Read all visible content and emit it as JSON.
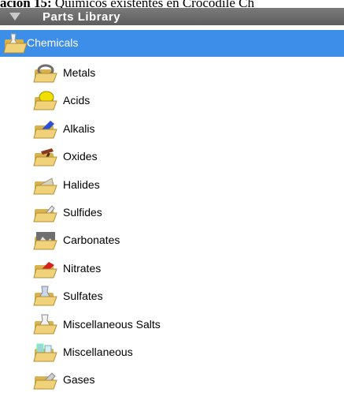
{
  "caption": {
    "bold_part": "ación 15:",
    "rest": " Químicos existentes en Crocodile Ch"
  },
  "panel": {
    "title": "Parts Library"
  },
  "tree": {
    "root": {
      "label": "Chemicals",
      "icon": "folder-flask-icon",
      "selected": true
    },
    "children": [
      {
        "label": "Metals",
        "icon": "metal-coil-icon",
        "accent": "#6e6e6e"
      },
      {
        "label": "Acids",
        "icon": "acid-drop-icon",
        "accent": "#f0e000"
      },
      {
        "label": "Alkalis",
        "icon": "alkali-bottle-icon",
        "accent": "#2a4fd8"
      },
      {
        "label": "Oxides",
        "icon": "oxide-hammer-icon",
        "accent": "#8a3b1e"
      },
      {
        "label": "Halides",
        "icon": "halide-cone-icon",
        "accent": "#d9d2b8"
      },
      {
        "label": "Sulfides",
        "icon": "sulfide-flask-icon",
        "accent": "#e8e8e8"
      },
      {
        "label": "Carbonates",
        "icon": "carbonate-rock-icon",
        "accent": "#6f6f6f"
      },
      {
        "label": "Nitrates",
        "icon": "nitrate-crystal-icon",
        "accent": "#d62020"
      },
      {
        "label": "Sulfates",
        "icon": "sulfate-beaker-icon",
        "accent": "#c9d8f0"
      },
      {
        "label": "Miscellaneous Salts",
        "icon": "salts-beaker-icon",
        "accent": "#e6b3c8"
      },
      {
        "label": "Miscellaneous",
        "icon": "misc-glassware-icon",
        "accent": "#9fd4d8"
      },
      {
        "label": "Gases",
        "icon": "gas-cylinder-icon",
        "accent": "#cfcfcf"
      }
    ]
  },
  "colors": {
    "selection": "#3d8ee9",
    "header": "#6a6a6a",
    "folder": "#e8c35c"
  }
}
